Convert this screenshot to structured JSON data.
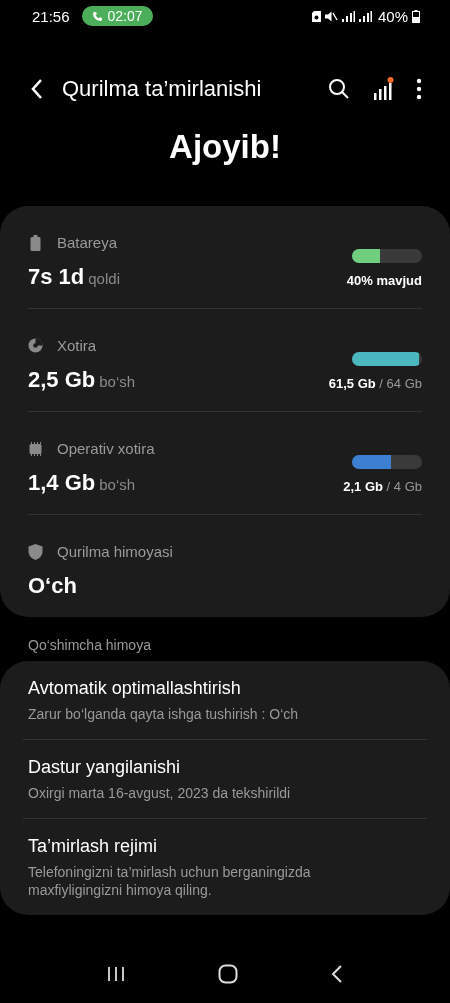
{
  "status_bar": {
    "time": "21:56",
    "call_time": "02:07",
    "battery": "40%"
  },
  "header": {
    "title": "Qurilma ta’mirlanishi"
  },
  "headline": "Ajoyib!",
  "status_items": [
    {
      "kind": "battery",
      "label": "Batareya",
      "value": "7s 1d",
      "unit": "qoldi",
      "level": 0.4,
      "color": "#6fcf7f",
      "reading": "40% mavjud"
    },
    {
      "kind": "storage",
      "label": "Xotira",
      "value": "2,5 Gb",
      "unit": "bo‘sh",
      "level": 0.96,
      "color": "#4bb8c0",
      "reading": "**61,5 Gb** / 64 Gb"
    },
    {
      "kind": "memory",
      "label": "Operativ xotira",
      "value": "1,4 Gb",
      "unit": "bo‘sh",
      "level": 0.55,
      "color": "#3d7fd0",
      "reading": "**2,1 Gb** / 4 Gb"
    },
    {
      "kind": "protection",
      "label": "Qurilma himoyasi",
      "value": "O‘ch"
    }
  ],
  "section_title": "Qo‘shimcha himoya",
  "options": [
    {
      "title": "Avtomatik optimallashtirish",
      "subtitle": "Zarur bo‘lganda qayta ishga tushirish : O‘ch"
    },
    {
      "title": "Dastur yangilanishi",
      "subtitle": "Oxirgi marta 16-avgust, 2023 da tekshirildi"
    },
    {
      "title": "Ta’mirlash rejimi",
      "subtitle": "Telefoningizni ta’mirlash uchun berganingizda maxfiyligingizni himoya qiling."
    }
  ]
}
